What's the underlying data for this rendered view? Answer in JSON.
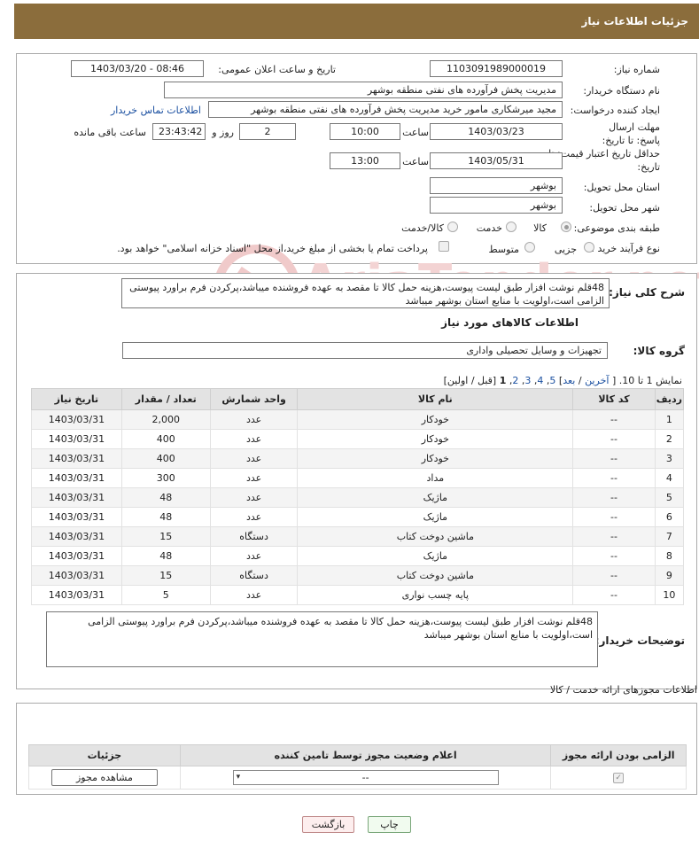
{
  "header": {
    "title": "جزئیات اطلاعات نیاز"
  },
  "form": {
    "need_number_label": "شماره نیاز:",
    "need_number": "1103091989000019",
    "announce_label": "تاریخ و ساعت اعلان عمومی:",
    "announce_value": "1403/03/20 - 08:46",
    "buyer_org_label": "نام دستگاه خریدار:",
    "buyer_org": "مدیریت پخش فرآورده های نفتی منطقه بوشهر",
    "creator_label": "ایجاد کننده درخواست:",
    "creator": "مجید میرشکاری مامور خرید مدیریت پخش فرآورده های نفتی منطقه بوشهر",
    "contact_link": "اطلاعات تماس خریدار",
    "reply_deadline_label": "مهلت ارسال پاسخ: تا تاریخ:",
    "reply_date": "1403/03/23",
    "time_label": "ساعت",
    "reply_time": "10:00",
    "days_count": "2",
    "days_label": "روز و",
    "remaining_time": "23:43:42",
    "remaining_label": "ساعت باقی مانده",
    "price_validity_label": "حداقل تاریخ اعتبار قیمت: تا تاریخ:",
    "validity_date": "1403/05/31",
    "validity_time": "13:00",
    "province_label": "استان محل تحویل:",
    "province": "بوشهر",
    "city_label": "شهر محل تحویل:",
    "city": "بوشهر",
    "category_label": "طبقه بندی موضوعی:",
    "category_options": [
      "کالا",
      "خدمت",
      "کالا/خدمت"
    ],
    "process_label": "نوع فرآیند خرید :",
    "process_options": [
      "جزیی",
      "متوسط"
    ],
    "payment_note": "پرداخت تمام یا بخشی از مبلغ خرید،از محل \"اسناد خزانه اسلامی\" خواهد بود."
  },
  "description": {
    "label": "شرح کلی نیاز:",
    "text": "48قلم نوشت افزار طبق لیست پیوست،هزینه حمل کالا تا مقصد به عهده فروشنده میباشد،پرکردن فرم براورد پیوستی الزامی است،اولویت با منابع استان بوشهر میباشد"
  },
  "goods": {
    "section_title": "اطلاعات کالاهای مورد نیاز",
    "group_label": "گروه کالا:",
    "group_value": "تجهیزات و وسایل تحصیلی واداری",
    "pagination": {
      "prefix": "نمایش 1 تا 10. [",
      "last": "آخرین",
      "next": "بعد",
      "pages": [
        "5",
        "4",
        "3",
        "2"
      ],
      "current": "1",
      "suffix": "[قبل / اولین]",
      "sep": "/",
      "close": "]"
    },
    "columns": [
      "ردیف",
      "کد کالا",
      "نام کالا",
      "واحد شمارش",
      "تعداد / مقدار",
      "تاریخ نیاز"
    ],
    "rows": [
      {
        "idx": "1",
        "code": "--",
        "name": "خودکار",
        "unit": "عدد",
        "qty": "2,000",
        "date": "1403/03/31"
      },
      {
        "idx": "2",
        "code": "--",
        "name": "خودکار",
        "unit": "عدد",
        "qty": "400",
        "date": "1403/03/31"
      },
      {
        "idx": "3",
        "code": "--",
        "name": "خودکار",
        "unit": "عدد",
        "qty": "400",
        "date": "1403/03/31"
      },
      {
        "idx": "4",
        "code": "--",
        "name": "مداد",
        "unit": "عدد",
        "qty": "300",
        "date": "1403/03/31"
      },
      {
        "idx": "5",
        "code": "--",
        "name": "ماژیک",
        "unit": "عدد",
        "qty": "48",
        "date": "1403/03/31"
      },
      {
        "idx": "6",
        "code": "--",
        "name": "ماژیک",
        "unit": "عدد",
        "qty": "48",
        "date": "1403/03/31"
      },
      {
        "idx": "7",
        "code": "--",
        "name": "ماشین دوخت کتاب",
        "unit": "دستگاه",
        "qty": "15",
        "date": "1403/03/31"
      },
      {
        "idx": "8",
        "code": "--",
        "name": "ماژیک",
        "unit": "عدد",
        "qty": "48",
        "date": "1403/03/31"
      },
      {
        "idx": "9",
        "code": "--",
        "name": "ماشین دوخت کتاب",
        "unit": "دستگاه",
        "qty": "15",
        "date": "1403/03/31"
      },
      {
        "idx": "10",
        "code": "--",
        "name": "پایه چسب نواری",
        "unit": "عدد",
        "qty": "5",
        "date": "1403/03/31"
      }
    ]
  },
  "buyer_notes": {
    "label": "توضیحات خریدار:",
    "text": "48قلم نوشت افزار طبق لیست پیوست،هزینه حمل کالا تا مقصد به عهده فروشنده میباشد،پرکردن فرم براورد پیوستی الزامی است،اولویت با منابع استان بوشهر میباشد"
  },
  "permits": {
    "title": "اطلاعات مجوزهای ارائه خدمت / کالا",
    "columns": [
      "الزامی بودن ارائه مجوز",
      "اعلام وضعیت مجوز توسط تامین کننده",
      "جزئیات"
    ],
    "select_value": "--",
    "view_button": "مشاهده مجوز"
  },
  "buttons": {
    "print": "چاپ",
    "back": "بازگشت"
  },
  "watermark": "AriaTender.net",
  "colors": {
    "header_bg": "#8b6d3c",
    "link": "#1a4fa0"
  }
}
